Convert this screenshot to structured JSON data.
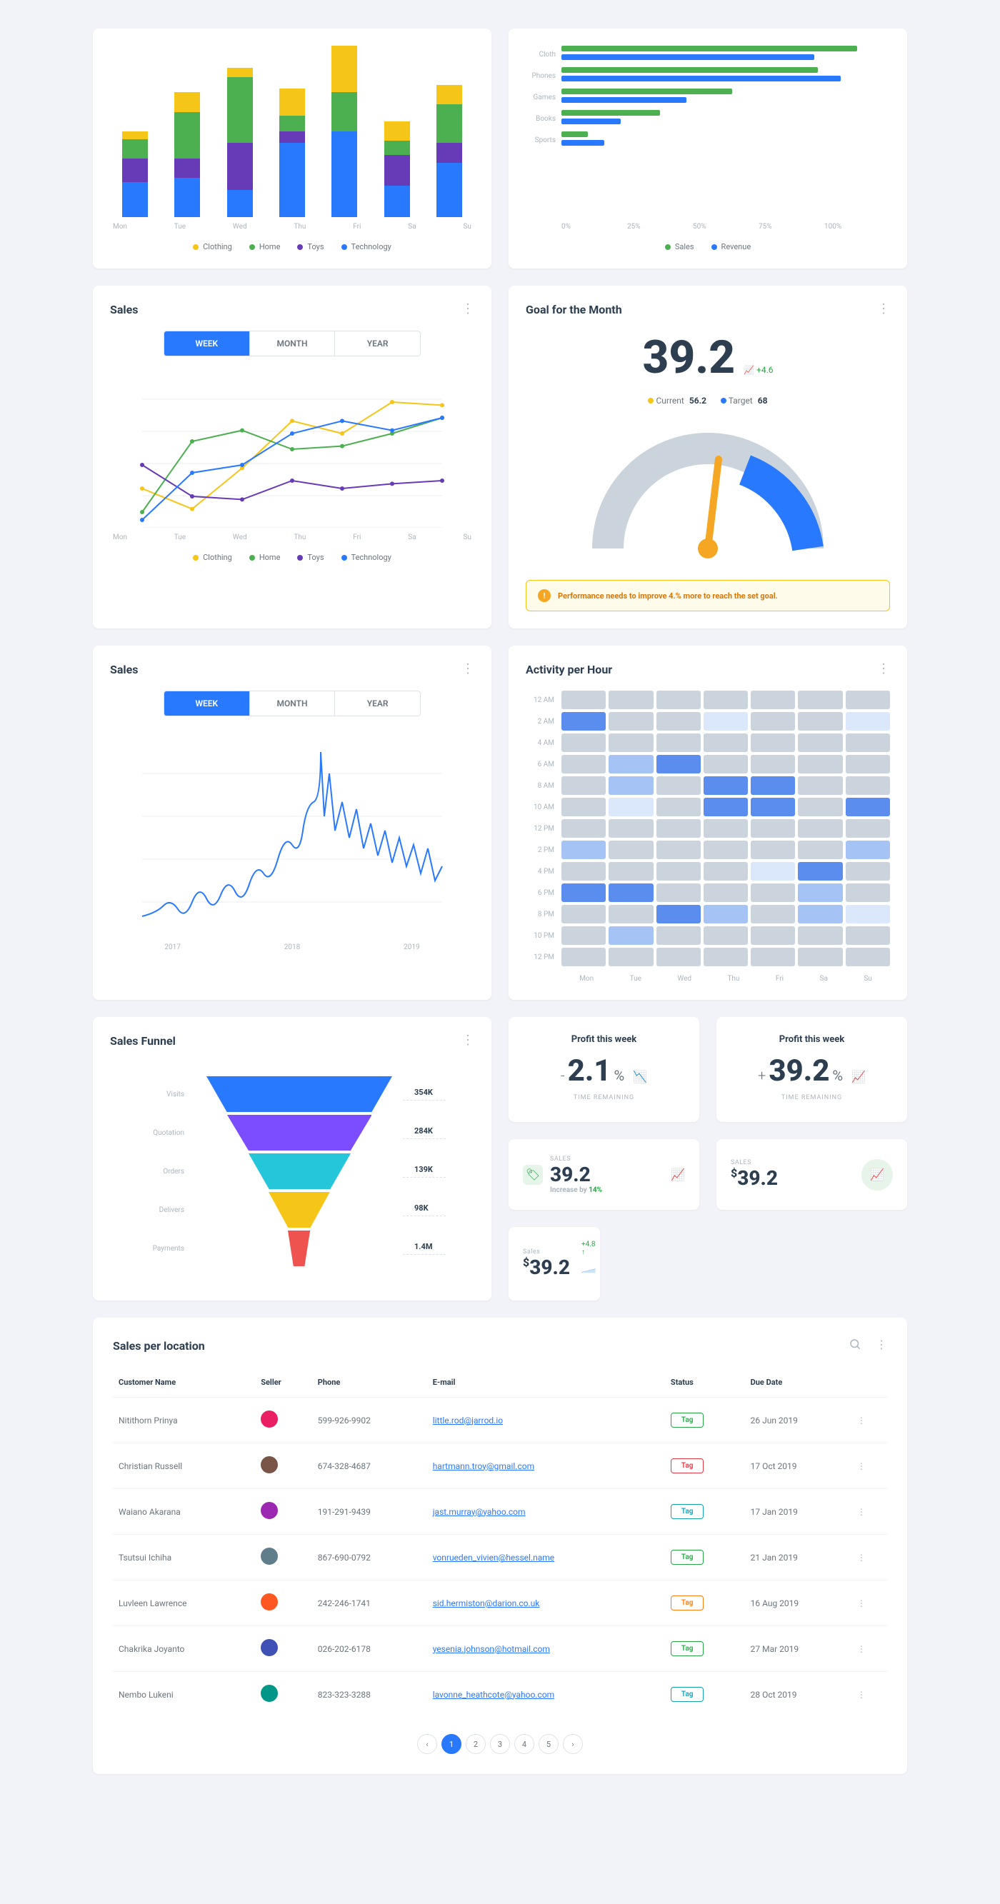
{
  "chart_data": [
    {
      "type": "bar_stacked",
      "title": "",
      "categories": [
        "Mon",
        "Tue",
        "Wed",
        "Thu",
        "Fri",
        "Sa",
        "Su"
      ],
      "series": [
        {
          "name": "Technology",
          "color": "#2979ff",
          "values": [
            45,
            50,
            35,
            95,
            110,
            40,
            70
          ]
        },
        {
          "name": "Toys",
          "color": "#673ab7",
          "values": [
            30,
            25,
            60,
            15,
            0,
            40,
            25
          ]
        },
        {
          "name": "Home",
          "color": "#4caf50",
          "values": [
            25,
            60,
            85,
            20,
            50,
            18,
            50
          ]
        },
        {
          "name": "Clothing",
          "color": "#f5c518",
          "values": [
            10,
            25,
            12,
            35,
            60,
            25,
            25
          ]
        }
      ]
    },
    {
      "type": "bar_grouped_horizontal",
      "title": "",
      "categories": [
        "Cloth",
        "Phones",
        "Games",
        "Books",
        "Sports"
      ],
      "series": [
        {
          "name": "Sales",
          "color": "#4caf50",
          "values": [
            90,
            78,
            52,
            30,
            8
          ]
        },
        {
          "name": "Revenue",
          "color": "#2979ff",
          "values": [
            77,
            85,
            38,
            18,
            13
          ]
        }
      ],
      "xlim": [
        0,
        100
      ],
      "xticks": [
        "0%",
        "25%",
        "50%",
        "75%",
        "100%"
      ]
    },
    {
      "type": "line",
      "title": "Sales",
      "tabs": [
        "WEEK",
        "MONTH",
        "YEAR"
      ],
      "active_tab": "WEEK",
      "categories": [
        "Mon",
        "Tue",
        "Wed",
        "Thu",
        "Fri",
        "Sa",
        "Su"
      ],
      "series": [
        {
          "name": "Clothing",
          "color": "#f5c518",
          "values": [
            25,
            12,
            38,
            68,
            60,
            80,
            78
          ]
        },
        {
          "name": "Home",
          "color": "#4caf50",
          "values": [
            10,
            55,
            62,
            50,
            52,
            60,
            70
          ]
        },
        {
          "name": "Toys",
          "color": "#673ab7",
          "values": [
            40,
            20,
            18,
            30,
            25,
            28,
            30
          ]
        },
        {
          "name": "Technology",
          "color": "#2979ff",
          "values": [
            5,
            35,
            40,
            60,
            68,
            62,
            70
          ]
        }
      ]
    },
    {
      "type": "gauge",
      "title": "Goal for the Month",
      "value": 39.2,
      "delta": "+4.6",
      "current_label": "Current",
      "current_value": 56.2,
      "target_label": "Target",
      "target_value": 68,
      "alert": "Performance needs to improve 4.% more to reach the set goal."
    },
    {
      "type": "line",
      "title": "Sales",
      "tabs": [
        "WEEK",
        "MONTH",
        "YEAR"
      ],
      "active_tab": "WEEK",
      "categories": [
        "2017",
        "2018",
        "2019"
      ],
      "note": "sparkline timeseries"
    },
    {
      "type": "heatmap",
      "title": "Activity per Hour",
      "ylabels": [
        "12 AM",
        "2 AM",
        "4 AM",
        "6 AM",
        "8 AM",
        "10 AM",
        "12 PM",
        "2 PM",
        "4 PM",
        "6 PM",
        "8 PM",
        "10 PM",
        "12 PM"
      ],
      "xlabels": [
        "Mon",
        "Tue",
        "Wed",
        "Thu",
        "Fri",
        "Sa",
        "Su"
      ],
      "levels": [
        [
          0,
          0,
          0,
          0,
          0,
          0,
          0
        ],
        [
          3,
          0,
          0,
          1,
          0,
          0,
          1
        ],
        [
          0,
          0,
          0,
          0,
          0,
          0,
          0
        ],
        [
          0,
          2,
          3,
          0,
          0,
          0,
          0
        ],
        [
          0,
          2,
          0,
          3,
          3,
          0,
          0
        ],
        [
          0,
          1,
          0,
          3,
          3,
          0,
          3
        ],
        [
          0,
          0,
          0,
          0,
          0,
          0,
          0
        ],
        [
          2,
          0,
          0,
          0,
          0,
          0,
          2
        ],
        [
          0,
          0,
          0,
          0,
          1,
          3,
          0
        ],
        [
          3,
          3,
          0,
          0,
          0,
          2,
          0
        ],
        [
          0,
          0,
          3,
          2,
          0,
          2,
          1
        ],
        [
          0,
          2,
          0,
          0,
          0,
          0,
          0
        ],
        [
          0,
          0,
          0,
          0,
          0,
          0,
          0
        ]
      ]
    },
    {
      "type": "funnel",
      "title": "Sales Funnel",
      "stages": [
        {
          "label": "Visits",
          "value": "354K",
          "color": "#2979ff",
          "width": 100
        },
        {
          "label": "Quotation",
          "value": "284K",
          "color": "#7c4dff",
          "width": 78
        },
        {
          "label": "Orders",
          "value": "139K",
          "color": "#26c6da",
          "width": 55
        },
        {
          "label": "Delivers",
          "value": "98K",
          "color": "#f5c518",
          "width": 33
        },
        {
          "label": "Payments",
          "value": "1.4M",
          "color": "#ef5350",
          "width": 12
        }
      ]
    }
  ],
  "kpis": {
    "profit_week_down": {
      "title": "Profit this week",
      "sign": "-",
      "value": "2.1",
      "sub": "TIME REMAINING"
    },
    "profit_week_up": {
      "title": "Profit this week",
      "sign": "+",
      "value": "39.2",
      "sub": "TIME REMAINING"
    },
    "sales_tag": {
      "label": "SALES",
      "value": "39.2",
      "sub_prefix": "Increase by",
      "sub_value": "14%"
    },
    "sales_dollar": {
      "label": "SALES",
      "value": "39.2"
    },
    "sales_spark": {
      "label": "Sales",
      "value": "39.2",
      "delta": "+4.8 ↑"
    }
  },
  "table": {
    "title": "Sales per location",
    "columns": [
      "Customer Name",
      "Seller",
      "Phone",
      "E-mail",
      "Status",
      "Due Date"
    ],
    "rows": [
      {
        "name": "Nitithorn Prinya",
        "avatar": "#e91e63",
        "phone": "599-926-9902",
        "email": "little.rod@jarrod.io",
        "tag": "Tag",
        "tag_class": "tag-green",
        "date": "26 Jun 2019"
      },
      {
        "name": "Christian Russell",
        "avatar": "#795548",
        "phone": "674-328-4687",
        "email": "hartmann.troy@gmail.com",
        "tag": "Tag",
        "tag_class": "tag-red",
        "date": "17 Oct 2019"
      },
      {
        "name": "Waiano Akarana",
        "avatar": "#9c27b0",
        "phone": "191-291-9439",
        "email": "jast.murray@yahoo.com",
        "tag": "Tag",
        "tag_class": "tag-teal",
        "date": "17 Jan 2019"
      },
      {
        "name": "Tsutsui Ichiha",
        "avatar": "#607d8b",
        "phone": "867-690-0792",
        "email": "vonrueden_vivien@hessel.name",
        "tag": "Tag",
        "tag_class": "tag-green",
        "date": "21 Jan 2019"
      },
      {
        "name": "Luvleen Lawrence",
        "avatar": "#ff5722",
        "phone": "242-246-1741",
        "email": "sid.hermiston@darion.co.uk",
        "tag": "Tag",
        "tag_class": "tag-orange",
        "date": "16 Aug 2019"
      },
      {
        "name": "Chakrika Joyanto",
        "avatar": "#3f51b5",
        "phone": "026-202-6178",
        "email": "yesenia.johnson@hotmail.com",
        "tag": "Tag",
        "tag_class": "tag-green",
        "date": "27 Mar 2019"
      },
      {
        "name": "Nembo Lukeni",
        "avatar": "#009688",
        "phone": "823-323-3288",
        "email": "lavonne_heathcote@yahoo.com",
        "tag": "Tag",
        "tag_class": "tag-teal",
        "date": "28 Oct 2019"
      }
    ],
    "pages": [
      "1",
      "2",
      "3",
      "4",
      "5"
    ]
  }
}
